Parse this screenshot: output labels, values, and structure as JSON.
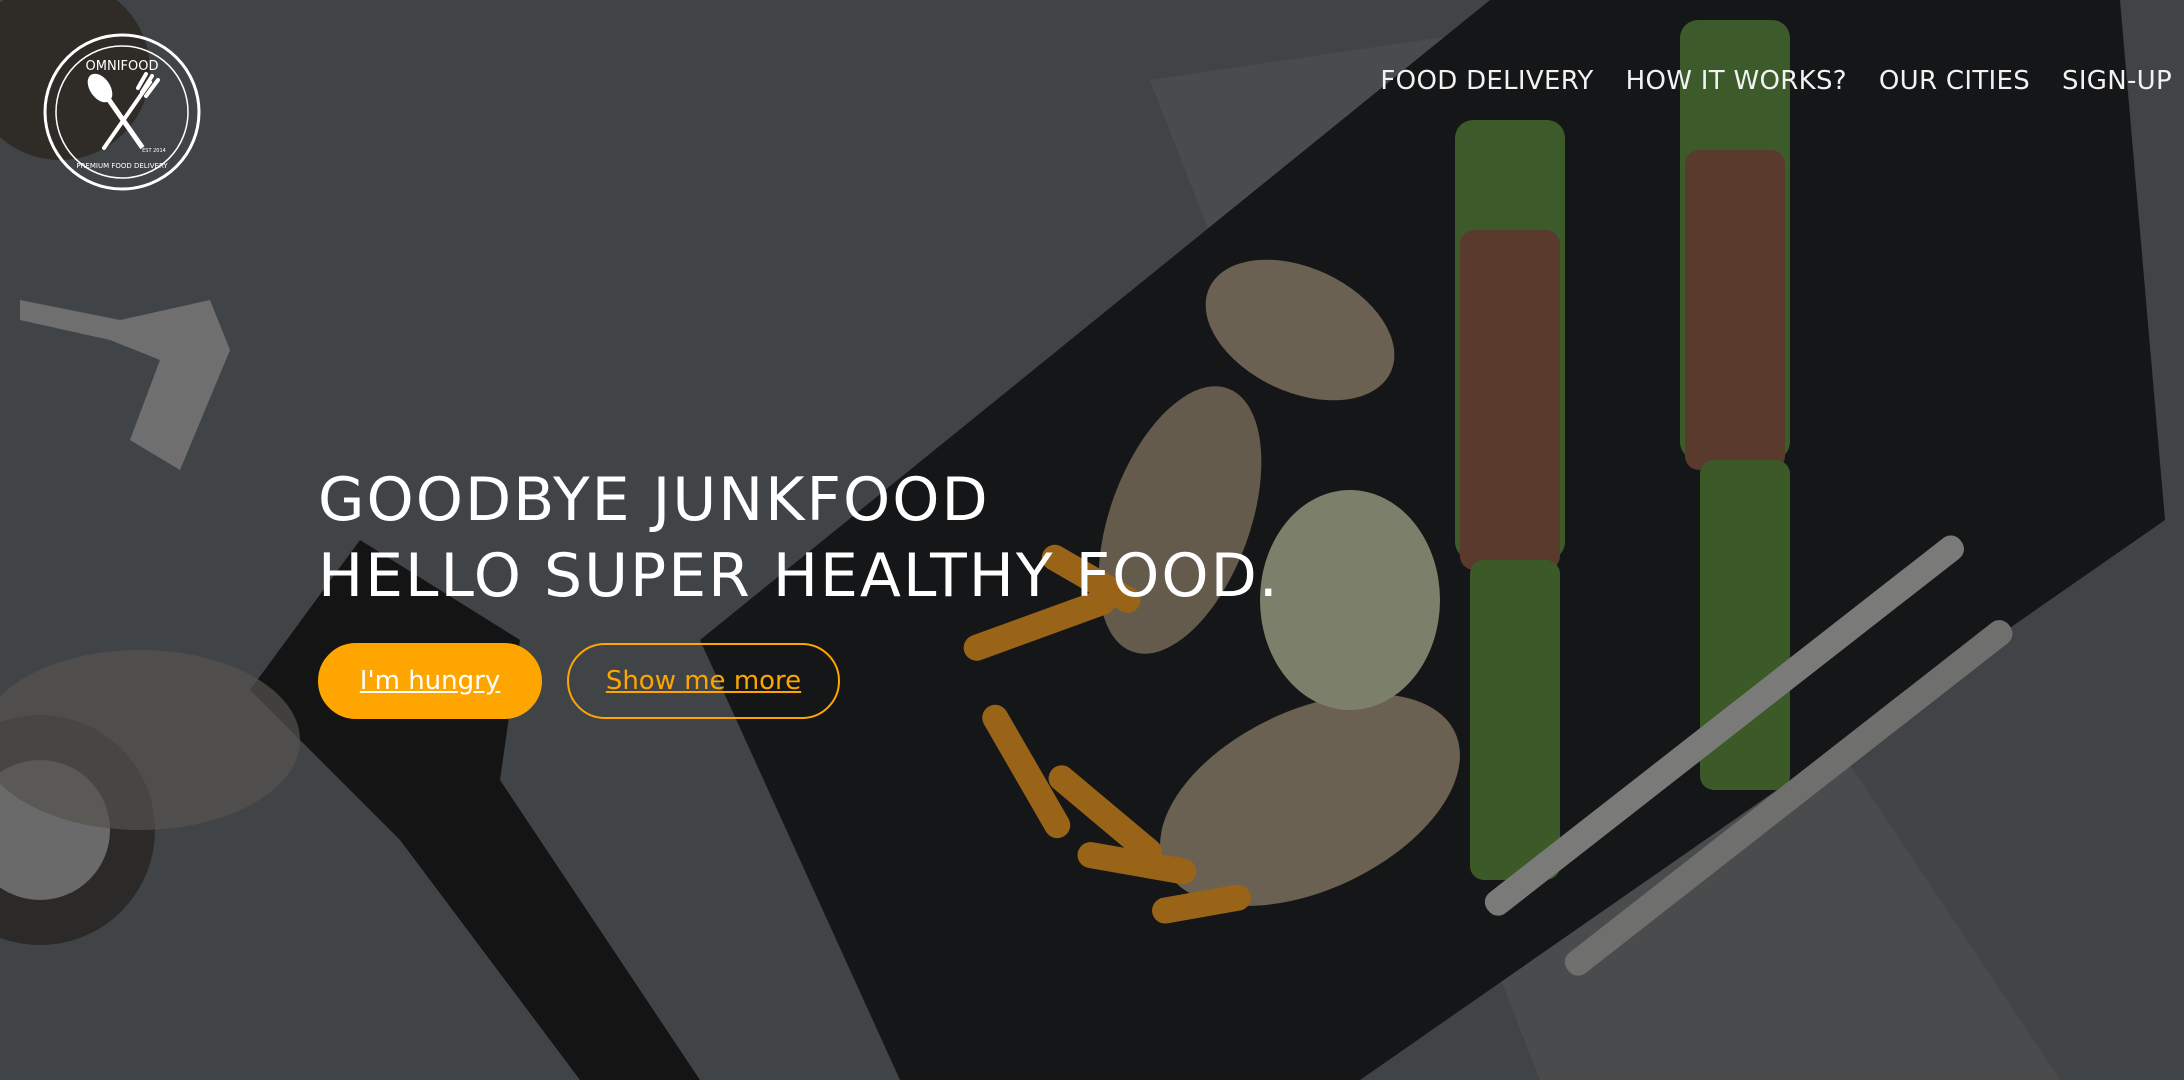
{
  "brand": {
    "logo_text": "OMNIFOOD",
    "logo_tagline": "PREMIUM FOOD DELIVERY",
    "logo_est": "EST 2014"
  },
  "nav": {
    "items": [
      {
        "label": "FOOD DELIVERY"
      },
      {
        "label": "HOW IT WORKS?"
      },
      {
        "label": "OUR CITIES"
      },
      {
        "label": "SIGN-UP"
      }
    ]
  },
  "hero": {
    "headline_line1": "GOODBYE JUNKFOOD",
    "headline_line2": "HELLO SUPER HEALTHY FOOD.",
    "primary_button": "I'm hungry",
    "secondary_button": "Show me more"
  },
  "colors": {
    "accent": "#ffa500",
    "text": "#ffffff",
    "overlay": "#3d4043"
  }
}
